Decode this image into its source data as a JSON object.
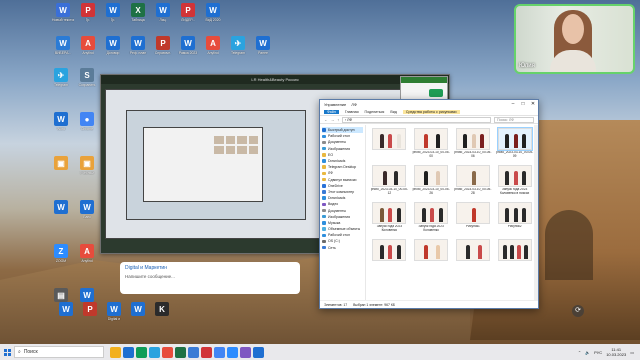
{
  "desktop": {
    "icons_top_row1": [
      {
        "label": "Новый текстовый",
        "color": "#3a6fd8",
        "glyph": "W",
        "icon": "document-icon"
      },
      {
        "label": "Гр.",
        "color": "#d13438",
        "glyph": "P",
        "icon": "pdf-icon"
      },
      {
        "label": "Гр.",
        "color": "#1f6fd1",
        "glyph": "W",
        "icon": "word-icon"
      },
      {
        "label": "Таблица",
        "color": "#1e7145",
        "glyph": "X",
        "icon": "excel-icon"
      },
      {
        "label": "Лиц.",
        "color": "#1f6fd1",
        "glyph": "W",
        "icon": "word-icon"
      },
      {
        "label": "ЛИДЕР...",
        "color": "#d13438",
        "glyph": "P",
        "icon": "pdf-icon"
      },
      {
        "label": "ВиД 2020",
        "color": "#1f6fd1",
        "glyph": "W",
        "icon": "word-icon"
      }
    ],
    "icons_top_row2": [
      {
        "label": "ВИБЕРА...",
        "color": "#2b7bd5",
        "glyph": "W",
        "icon": "word-icon"
      },
      {
        "label": "Anyfind",
        "color": "#e74c3c",
        "glyph": "A",
        "icon": "app-icon"
      },
      {
        "label": "Договор",
        "color": "#1f6fd1",
        "glyph": "W",
        "icon": "word-icon"
      },
      {
        "label": "Реф. план",
        "color": "#1f6fd1",
        "glyph": "W",
        "icon": "word-icon"
      },
      {
        "label": "Справочн.",
        "color": "#c0392b",
        "glyph": "P",
        "icon": "pdf-icon"
      },
      {
        "label": "Рамка 2023",
        "color": "#1f6fd1",
        "glyph": "W",
        "icon": "word-icon"
      },
      {
        "label": "Anyfind",
        "color": "#e74c3c",
        "glyph": "A",
        "icon": "app-icon"
      },
      {
        "label": "Telegram",
        "color": "#2aa3df",
        "glyph": "✈",
        "icon": "telegram-icon"
      },
      {
        "label": "Ранее",
        "color": "#1f6fd1",
        "glyph": "W",
        "icon": "word-icon"
      }
    ],
    "icons_left_col": [
      {
        "label": "Telegram",
        "color": "#2aa3df",
        "glyph": "✈",
        "icon": "telegram-icon"
      },
      {
        "label": "Word",
        "color": "#1f6fd1",
        "glyph": "W",
        "icon": "word-icon"
      },
      {
        "label": "",
        "color": "#e9a23b",
        "glyph": "▣",
        "icon": "folder-icon"
      },
      {
        "label": "",
        "color": "#1f6fd1",
        "glyph": "W",
        "icon": "word-icon"
      },
      {
        "label": "ZOOM",
        "color": "#2d8cff",
        "glyph": "Z",
        "icon": "zoom-icon"
      },
      {
        "label": "",
        "color": "#5a5a5a",
        "glyph": "▤",
        "icon": "document-icon"
      }
    ],
    "icons_left_col2": [
      {
        "label": "Сохранить",
        "color": "#5b7c99",
        "glyph": "S",
        "icon": "app-icon"
      },
      {
        "label": "Chrome",
        "color": "#4285f4",
        "glyph": "●",
        "icon": "chrome-icon"
      },
      {
        "label": "Учебный",
        "color": "#e9a23b",
        "glyph": "▣",
        "icon": "folder-icon"
      },
      {
        "label": "Банк",
        "color": "#1f6fd1",
        "glyph": "W",
        "icon": "word-icon"
      },
      {
        "label": "Anyfind",
        "color": "#e74c3c",
        "glyph": "A",
        "icon": "app-icon"
      },
      {
        "label": "ЛМС",
        "color": "#1f6fd1",
        "glyph": "W",
        "icon": "word-icon"
      }
    ],
    "icons_bottom": [
      {
        "label": "",
        "color": "#1f6fd1",
        "glyph": "W",
        "icon": "word-icon"
      },
      {
        "label": "",
        "color": "#c0392b",
        "glyph": "P",
        "icon": "pdf-icon"
      },
      {
        "label": "Digital и",
        "color": "#1f6fd1",
        "glyph": "W",
        "icon": "word-icon"
      },
      {
        "label": "",
        "color": "#1f6fd1",
        "glyph": "W",
        "icon": "word-icon"
      },
      {
        "label": "",
        "color": "#2b2b2b",
        "glyph": "K",
        "icon": "app-icon"
      }
    ]
  },
  "background_window": {
    "title": "LR Health&Beauty Россия"
  },
  "message_preview": {
    "name": "Digital и Маркетин",
    "text": "Напишите сообщение..."
  },
  "explorer": {
    "title_tabs": [
      "Управление",
      "ЛФ"
    ],
    "controls": [
      "–",
      "□",
      "✕"
    ],
    "ribbon": [
      "Файл",
      "Главная",
      "Поделиться",
      "Вид",
      "Средства работы с рисунками"
    ],
    "path": "› ЛФ",
    "search_placeholder": "Поиск: ЛФ",
    "nav": [
      {
        "label": "Быстрый доступ",
        "color": "#1f6fd1",
        "selected": true
      },
      {
        "label": "Рабочий стол",
        "color": "#2f8fdd"
      },
      {
        "label": "Документы",
        "color": "#8c8c8c"
      },
      {
        "label": "Изображения",
        "color": "#3a9bd5"
      },
      {
        "label": "ЕО",
        "color": "#e9b840"
      },
      {
        "label": "Downloads",
        "color": "#2f8fdd"
      },
      {
        "label": "Telegram Desktop",
        "color": "#e9b840"
      },
      {
        "label": "ЛФ",
        "color": "#e9b840"
      },
      {
        "label": "Сдвинул выписки",
        "color": "#e9b840"
      },
      {
        "label": "OneDrive",
        "color": "#2a72d8"
      },
      {
        "label": "Этот компьютер",
        "color": "#3a7bd5"
      },
      {
        "label": "Downloads",
        "color": "#2f8fdd"
      },
      {
        "label": "Видео",
        "color": "#7e57c2"
      },
      {
        "label": "Документы",
        "color": "#8c8c8c"
      },
      {
        "label": "Изображения",
        "color": "#3a9bd5"
      },
      {
        "label": "Музыка",
        "color": "#2f8fdd"
      },
      {
        "label": "Объемные объекты",
        "color": "#4fb0e0"
      },
      {
        "label": "Рабочий стол",
        "color": "#2f8fdd"
      },
      {
        "label": "OS (C:)",
        "color": "#6b6b6b"
      },
      {
        "label": "Сеть",
        "color": "#3a7bd5"
      }
    ],
    "files": [
      {
        "caption": "",
        "figures": [
          "#3a2a2a",
          "#c94a4a",
          "#e9e4dc"
        ],
        "selected": false
      },
      {
        "caption": "photo_2023-03-10_00-05-00",
        "figures": [
          "#c0392b",
          "#1f1f1f"
        ],
        "selected": false
      },
      {
        "caption": "photo_2023-03-10_00-05-06",
        "figures": [
          "#1f1f1f",
          "#e0c9b4",
          "#7a1f1f"
        ],
        "selected": false
      },
      {
        "caption": "photo_2023-03-10_00-05-09",
        "figures": [
          "#222",
          "#7a1f1f",
          "#222"
        ],
        "selected": true
      },
      {
        "caption": "photo_2023-03-10_00-05-12",
        "figures": [
          "#3a2a2a",
          "#2a2a2a"
        ],
        "selected": false
      },
      {
        "caption": "photo_2023-03-10_00-05-26",
        "figures": [
          "#1f1f1f",
          "#e0c9b4"
        ],
        "selected": false
      },
      {
        "caption": "photo_2023-03-10_00-05-28",
        "figures": [
          "#8a6a4a"
        ],
        "selected": false
      },
      {
        "caption": "Запуск года 2023 Коловенко в поясах",
        "figures": [
          "#2a2a2a",
          "#c94a4a",
          "#2a2a2a"
        ],
        "selected": false
      },
      {
        "caption": "Запуск года 2023 Коловенко",
        "figures": [
          "#7a5a3a",
          "#c94a4a",
          "#2a2a2a"
        ],
        "selected": false
      },
      {
        "caption": "Запуск года 2023 Коловенко",
        "figures": [
          "#2a2a2a",
          "#c94a4a",
          "#2a2a2a"
        ],
        "selected": false
      },
      {
        "caption": "Рисунок1",
        "figures": [
          "#c0392b"
        ],
        "selected": false
      },
      {
        "caption": "Рисунок2",
        "figures": [
          "#2a2a2a",
          "#2a2a2a",
          "#2a2a2a"
        ],
        "selected": false
      },
      {
        "caption": "",
        "figures": [
          "#2a2a2a",
          "#c94a4a",
          "#2a2a2a"
        ],
        "selected": false
      },
      {
        "caption": "",
        "figures": [
          "#c0392b",
          "#e9c9a9"
        ],
        "selected": false
      },
      {
        "caption": "",
        "figures": [
          "#2a2a2a",
          "#c94a4a"
        ],
        "selected": false
      },
      {
        "caption": "",
        "figures": [
          "#2a2a2a",
          "#2a2a2a",
          "#c94a4a",
          "#2a2a2a"
        ],
        "selected": false
      }
    ],
    "status": [
      "Элементов: 17",
      "Выбран 1 элемент: 967 КБ"
    ]
  },
  "webcam": {
    "name": "Юлия"
  },
  "taskbar": {
    "search_placeholder": "Поиск",
    "apps": [
      "#f2b01e",
      "#1f6fd1",
      "#0f9d58",
      "#2aa3df",
      "#e74c3c",
      "#1e7145",
      "#3a7bd5",
      "#d13438",
      "#4285f4",
      "#2d8cff",
      "#7e57c2",
      "#1f6fd1"
    ],
    "lang": "РУС",
    "time": "11:41",
    "date": "10.03.2023"
  }
}
